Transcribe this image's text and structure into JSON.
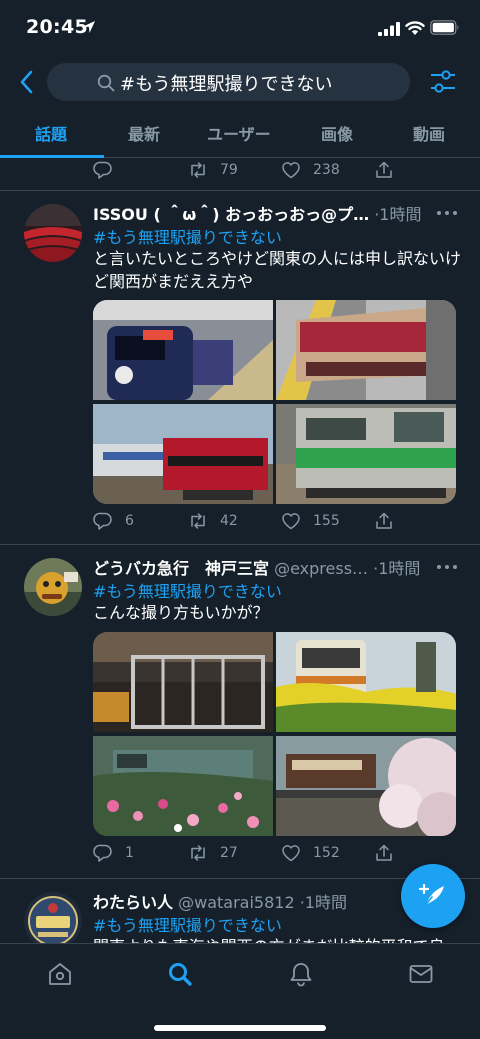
{
  "status_bar": {
    "time": "20:45"
  },
  "search": {
    "query": "#もう無理駅撮りできない"
  },
  "tabs": [
    "話題",
    "最新",
    "ユーザー",
    "画像",
    "動画"
  ],
  "previous_tweet_actions": {
    "replies": "",
    "retweets": "79",
    "likes": "238"
  },
  "tweets": [
    {
      "name": "ISSOU ( ＾ω＾) おっおっおっ@プ…",
      "handle": "",
      "time": "·1時間",
      "hashtag": "#もう無理駅撮りできない",
      "text": "と言いたいところやけど関東の人には申し訳ないけど関西がまだええ方や",
      "replies": "6",
      "retweets": "42",
      "likes": "155"
    },
    {
      "name": "どうバカ急行　神戸三宮",
      "handle": "@express…",
      "time": "·1時間",
      "hashtag": "#もう無理駅撮りできない",
      "text": "こんな撮り方もいかが？",
      "replies": "1",
      "retweets": "27",
      "likes": "152"
    },
    {
      "name": "わたらい人",
      "handle": "@watarai5812",
      "time": "·1時間",
      "hashtag": "#もう無理駅撮りできない",
      "text": "関東よりも東海や関西の方がまだ比較的平和で良"
    }
  ],
  "colors": {
    "background": "#15202b",
    "accent": "#1da1f2",
    "muted": "#8899a6",
    "divider": "#38444d"
  }
}
